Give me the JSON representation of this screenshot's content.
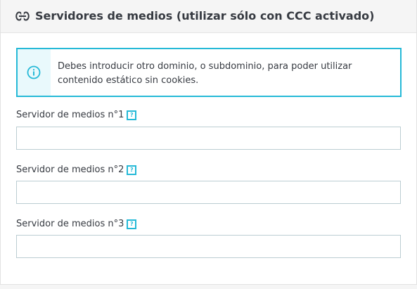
{
  "panel": {
    "title": "Servidores de medios (utilizar sólo con CCC activado)",
    "title_icon": "link-icon"
  },
  "alert": {
    "icon": "info-icon",
    "message": "Debes introducir otro dominio, o subdominio, para poder utilizar contenido estático sin cookies."
  },
  "fields": [
    {
      "label": "Servidor de medios n°1",
      "help": "?",
      "value": ""
    },
    {
      "label": "Servidor de medios n°2",
      "help": "?",
      "value": ""
    },
    {
      "label": "Servidor de medios n°3",
      "help": "?",
      "value": ""
    }
  ],
  "colors": {
    "accent": "#25b9d7",
    "header_bg": "#f5f5f5",
    "alert_icon_bg": "#e9f9fc",
    "input_border": "#bbcdd2",
    "text": "#363a41"
  }
}
